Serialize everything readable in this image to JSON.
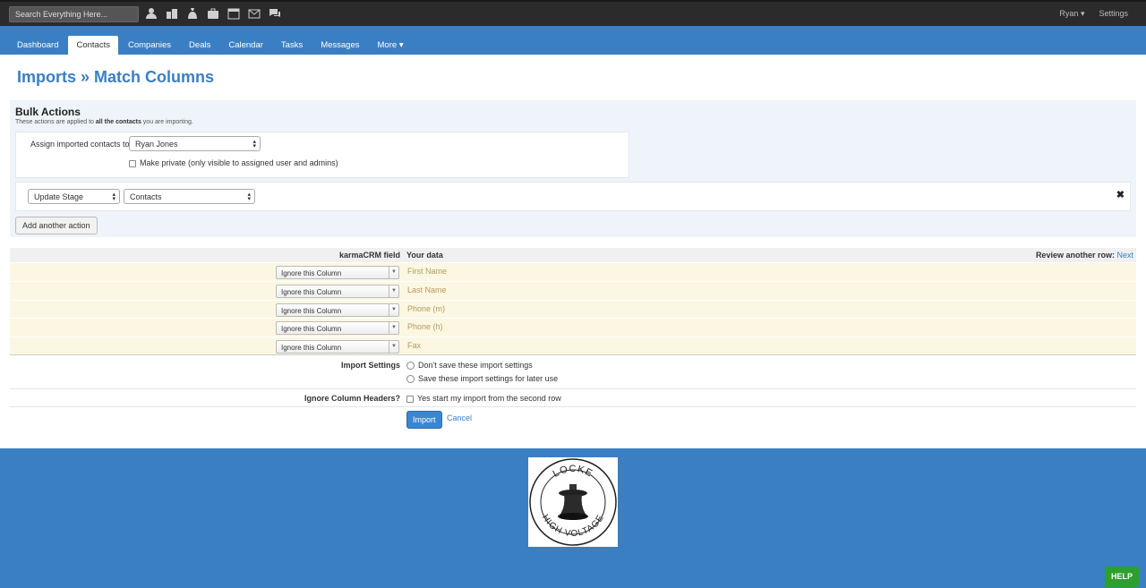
{
  "topbar": {
    "search_placeholder": "Search Everything Here...",
    "icons": [
      "person-icon",
      "building-icon",
      "money-bag-icon",
      "briefcase-icon",
      "calendar-icon",
      "mail-icon",
      "chat-icon"
    ],
    "user": "Ryan",
    "settings": "Settings"
  },
  "nav": {
    "items": [
      "Dashboard",
      "Contacts",
      "Companies",
      "Deals",
      "Calendar",
      "Tasks",
      "Messages",
      "More"
    ],
    "active": "Contacts"
  },
  "page": {
    "title": "Imports » Match Columns"
  },
  "bulk": {
    "title": "Bulk Actions",
    "subtitle_pre": "These actions are applied to ",
    "subtitle_bold": "all the contacts",
    "subtitle_post": " you are importing.",
    "assign_label": "Assign imported contacts to",
    "assign_value": "Ryan Jones",
    "private_label": "Make private (only visible to assigned user and admins)",
    "action_select": "Update Stage",
    "stage_select": "Contacts",
    "add_button": "Add another action"
  },
  "mapping": {
    "header_karma": "karmaCRM field",
    "header_data": "Your data",
    "review_label": "Review another row:",
    "review_link": "Next",
    "rows": [
      {
        "select": "Ignore this Column",
        "value": "First Name"
      },
      {
        "select": "Ignore this Column",
        "value": "Last Name"
      },
      {
        "select": "Ignore this Column",
        "value": "Phone (m)"
      },
      {
        "select": "Ignore this Column",
        "value": "Phone (h)"
      },
      {
        "select": "Ignore this Column",
        "value": "Fax"
      }
    ]
  },
  "settings": {
    "label": "Import Settings",
    "option1": "Don't save these import settings",
    "option2": "Save these import settings for later use",
    "ignore_label": "Ignore Column Headers?",
    "ignore_option": "Yes start my import from the second row"
  },
  "buttons": {
    "import": "Import",
    "cancel": "Cancel"
  },
  "footer": {
    "logo_top": "LOCKE",
    "logo_bottom": "HIGH VOLTAGE",
    "help": "HELP"
  },
  "colors": {
    "brand_blue": "#3a7fc4",
    "topbar": "#2b2b2b",
    "row_highlight": "#fbf7e2",
    "help_green": "#2ca02c"
  }
}
